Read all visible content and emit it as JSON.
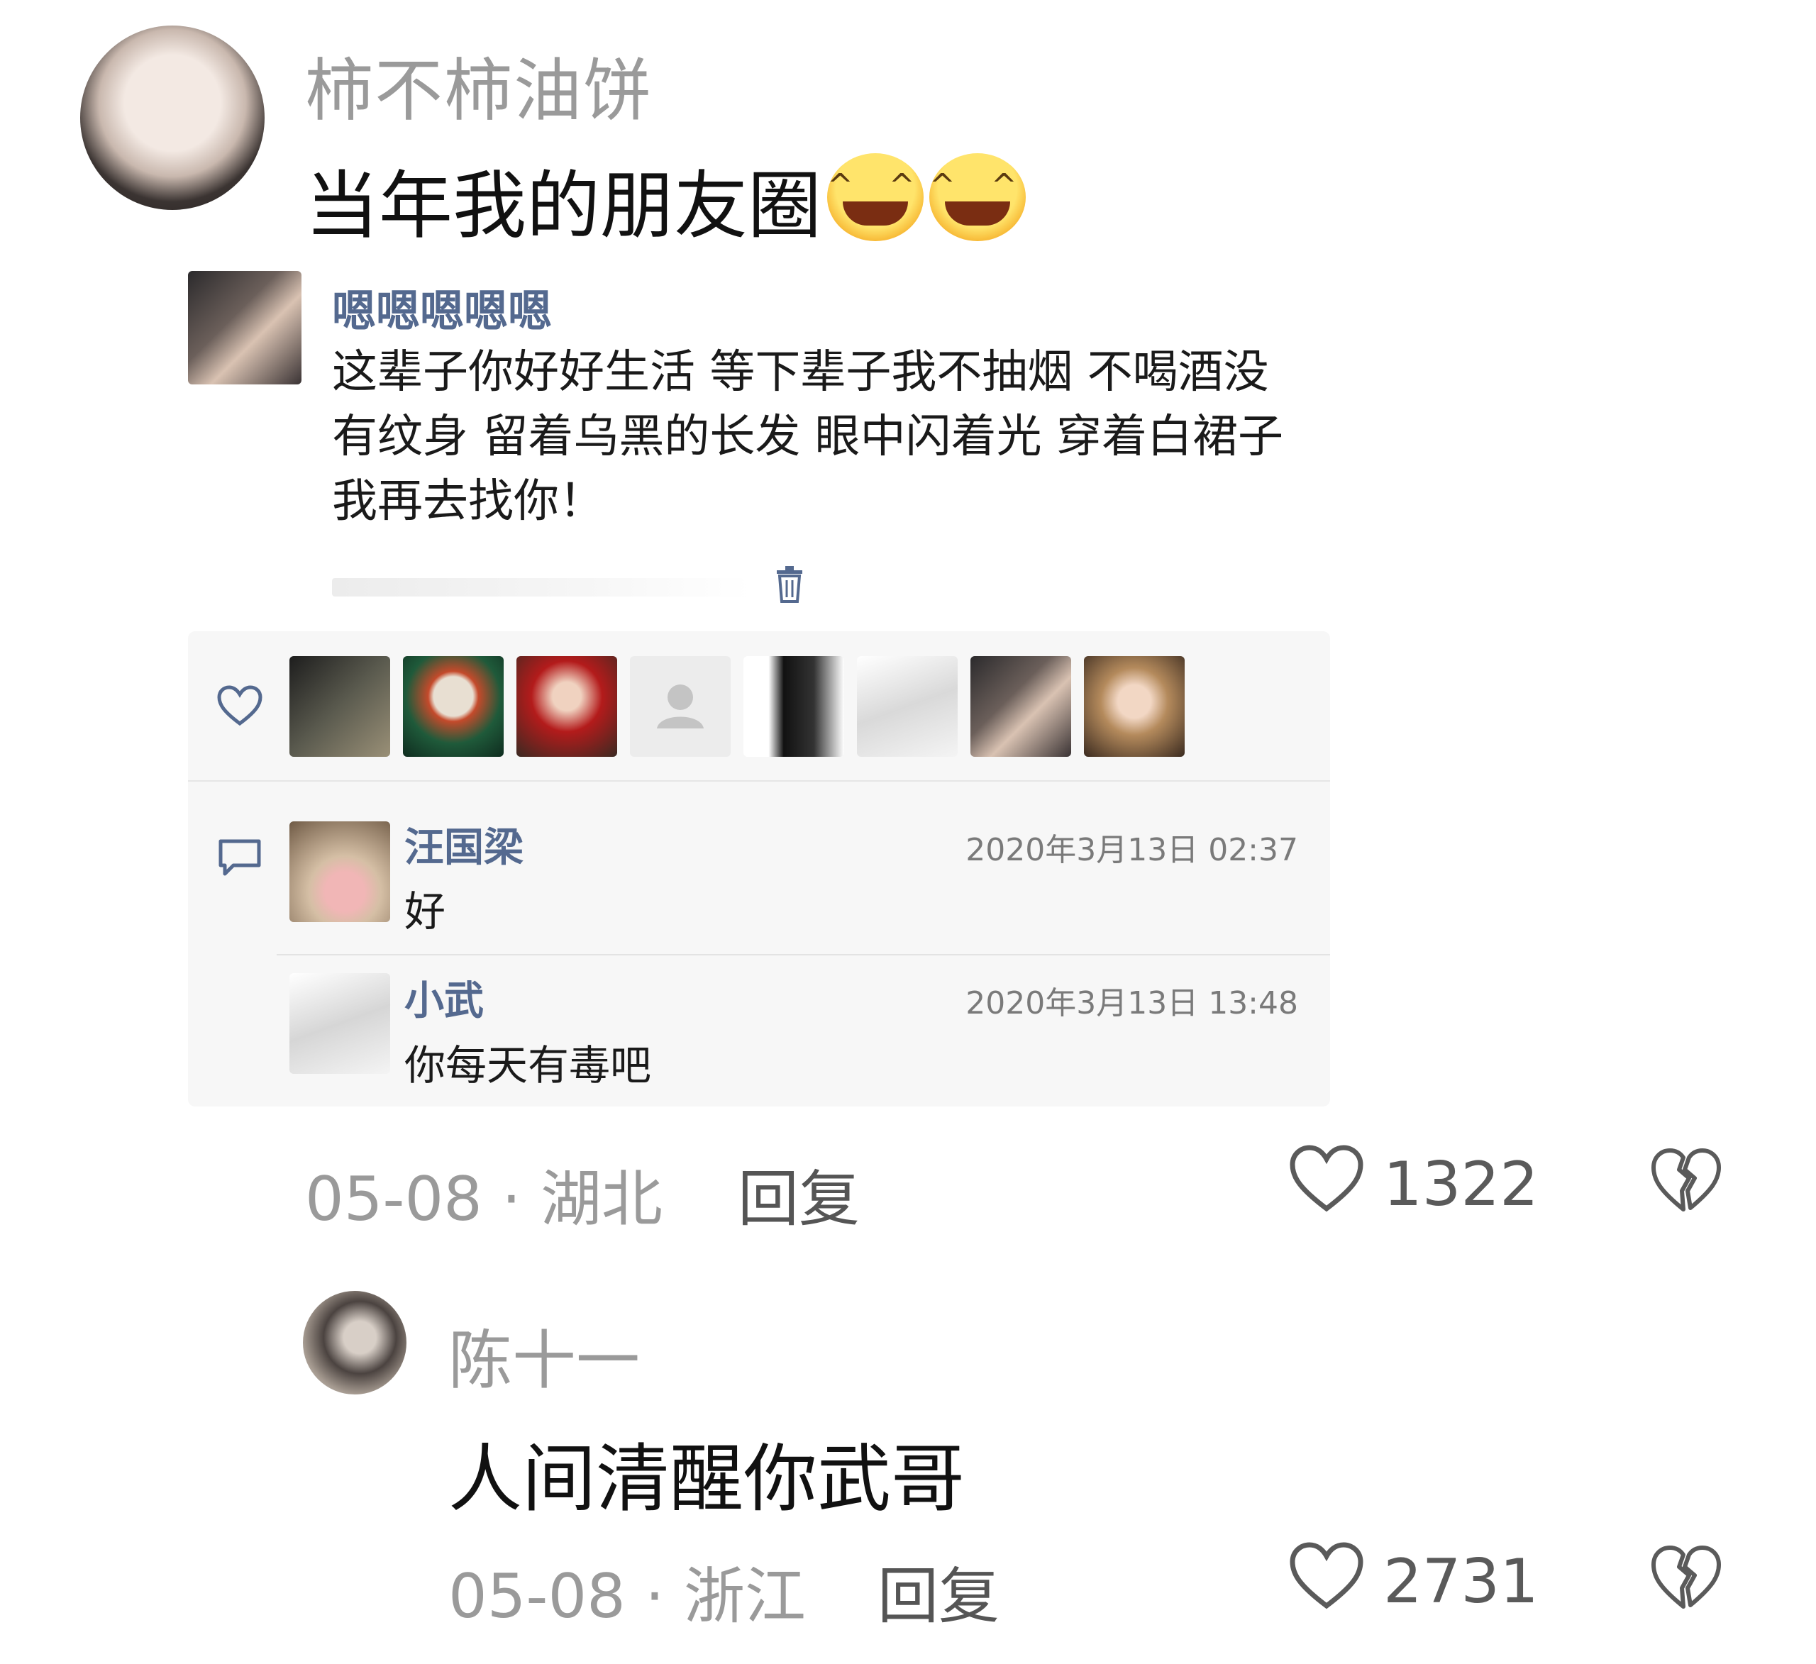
{
  "comments": [
    {
      "username": "柿不柿油饼",
      "text": "当年我的朋友圈",
      "emojis": [
        "grinning-face-icon",
        "grinning-face-icon"
      ],
      "date": "05-08",
      "separator": "·",
      "location": "湖北",
      "reply_label": "回复",
      "likes": "1322"
    },
    {
      "username": "陈十一",
      "text": "人间清醒你武哥",
      "date": "05-08",
      "separator": "·",
      "location": "浙江",
      "reply_label": "回复",
      "likes": "2731"
    }
  ],
  "moment": {
    "author": "嗯嗯嗯嗯嗯",
    "body_lines": [
      "这辈子你好好生活 等下辈子我不抽烟 不喝酒没",
      "有纹身 留着乌黑的长发 眼中闪着光 穿着白裙子",
      "我再去找你！"
    ],
    "replies": [
      {
        "name": "汪国梁",
        "time": "2020年3月13日 02:37",
        "text": "好"
      },
      {
        "name": "小武",
        "time": "2020年3月13日 13:48",
        "text": "你每天有毒吧"
      }
    ]
  },
  "colors": {
    "link_blue": "#54698f",
    "gray_text": "#9a9a9a",
    "panel_bg": "#f7f7f7"
  }
}
